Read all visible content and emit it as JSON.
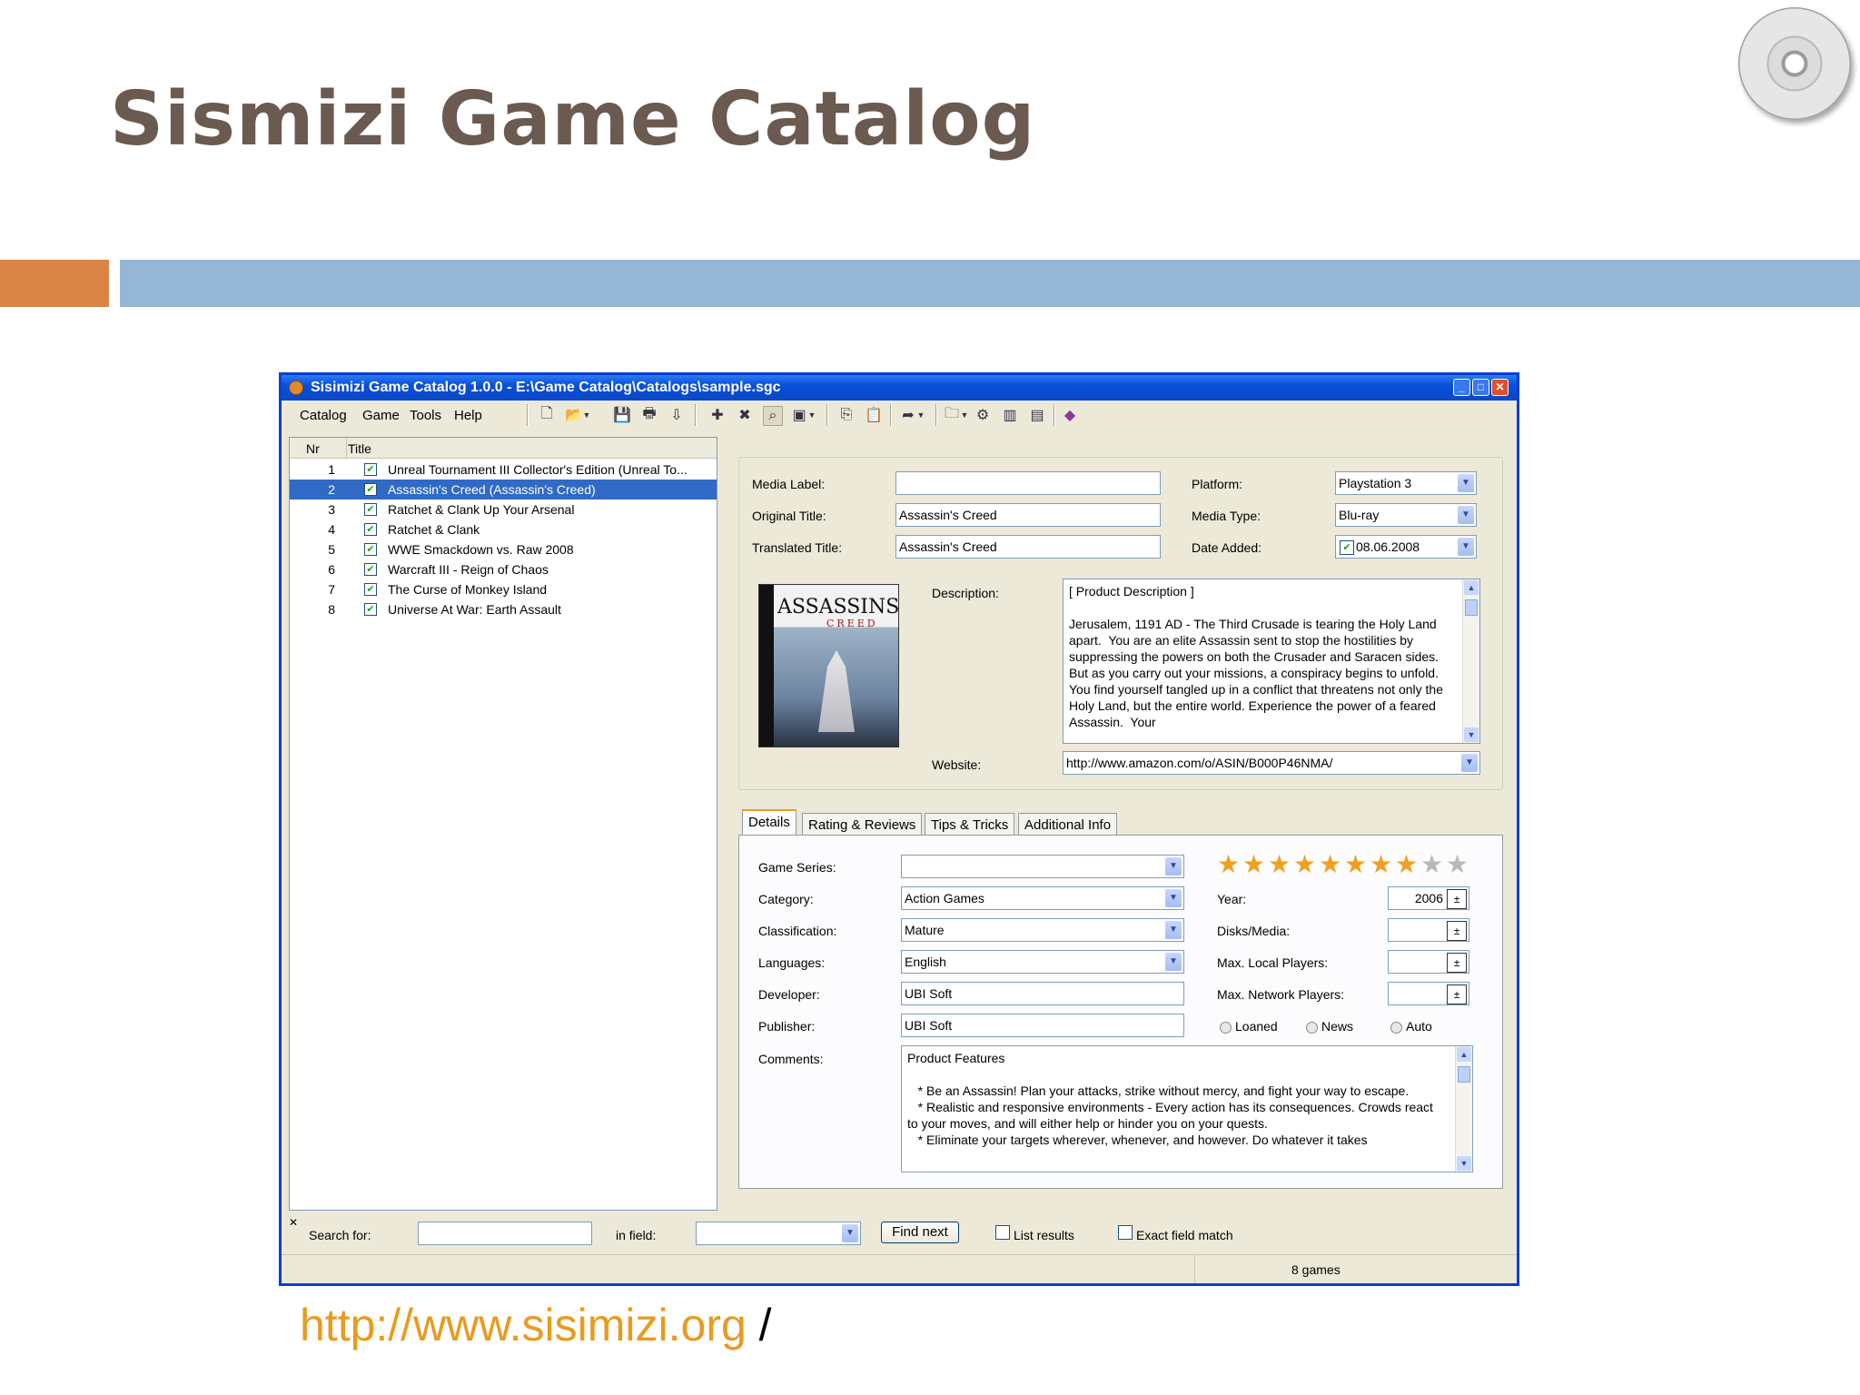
{
  "slide": {
    "title": "Sismizi Game Catalog",
    "url": "http://www.sisimizi.org",
    "url_suffix": " /",
    "colors": {
      "title": "#6a5a50",
      "accent_orange": "#d98548",
      "accent_blue": "#96b6d6",
      "url": "#e89b1e"
    }
  },
  "window": {
    "title": "Sisimizi Game Catalog 1.0.0 - E:\\Game Catalog\\Catalogs\\sample.sgc",
    "controls": [
      "minimize",
      "maximize",
      "close"
    ]
  },
  "menu": [
    "Catalog",
    "Game",
    "Tools",
    "Help"
  ],
  "toolbar_icons": [
    "new-icon",
    "open-icon",
    "dropdown-icon",
    "save-icon",
    "print-icon",
    "export-icon",
    "add-game-icon",
    "delete-game-icon",
    "find-icon",
    "picture-icon",
    "dropdown-icon",
    "copy-icon",
    "paste-icon",
    "move-icon",
    "dropdown-icon",
    "folder-icon",
    "dropdown-icon",
    "settings-icon",
    "statistics-icon",
    "report-icon",
    "help-book-icon"
  ],
  "list": {
    "headers": {
      "nr": "Nr",
      "title": "Title"
    },
    "rows": [
      {
        "nr": "1",
        "title": "Unreal Tournament III Collector's Edition (Unreal To...",
        "checked": true
      },
      {
        "nr": "2",
        "title": "Assassin's Creed (Assassin's Creed)",
        "checked": true,
        "selected": true
      },
      {
        "nr": "3",
        "title": "Ratchet & Clank Up Your Arsenal",
        "checked": true
      },
      {
        "nr": "4",
        "title": "Ratchet & Clank",
        "checked": true
      },
      {
        "nr": "5",
        "title": "WWE Smackdown vs. Raw 2008",
        "checked": true
      },
      {
        "nr": "6",
        "title": "Warcraft III - Reign of Chaos",
        "checked": true
      },
      {
        "nr": "7",
        "title": "The Curse of Monkey Island",
        "checked": true
      },
      {
        "nr": "8",
        "title": "Universe At War: Earth Assault",
        "checked": true
      }
    ]
  },
  "details": {
    "media_label": {
      "label": "Media Label:",
      "value": ""
    },
    "original_title": {
      "label": "Original Title:",
      "value": "Assassin's Creed"
    },
    "translated_title": {
      "label": "Translated Title:",
      "value": "Assassin's Creed"
    },
    "platform": {
      "label": "Platform:",
      "value": "Playstation 3"
    },
    "media_type": {
      "label": "Media Type:",
      "value": "Blu-ray"
    },
    "date_added": {
      "label": "Date Added:",
      "value": "08.06.2008"
    },
    "description": {
      "label": "Description:",
      "value": "[ Product Description ]\n\nJerusalem, 1191 AD - The Third Crusade is tearing the Holy Land apart.  You are an elite Assassin sent to stop the hostilities by suppressing the powers on both the Crusader and Saracen sides.  But as you carry out your missions, a conspiracy begins to unfold.  You find yourself tangled up in a conflict that threatens not only the Holy Land, but the entire world. Experience the power of a feared Assassin.  Your"
    },
    "website": {
      "label": "Website:",
      "value": "http://www.amazon.com/o/ASIN/B000P46NMA/"
    },
    "cover": {
      "title": "ASSASSINS",
      "subtitle": "CREED"
    }
  },
  "tabs": [
    "Details",
    "Rating & Reviews",
    "Tips & Tricks",
    "Additional Info"
  ],
  "tab_details": {
    "game_series": {
      "label": "Game Series:",
      "value": ""
    },
    "category": {
      "label": "Category:",
      "value": "Action Games"
    },
    "classification": {
      "label": "Classification:",
      "value": "Mature"
    },
    "languages": {
      "label": "Languages:",
      "value": "English"
    },
    "developer": {
      "label": "Developer:",
      "value": "UBI Soft"
    },
    "publisher": {
      "label": "Publisher:",
      "value": "UBI Soft"
    },
    "comments": {
      "label": "Comments:",
      "value": "Product Features\n\n   * Be an Assassin! Plan your attacks, strike without mercy, and fight your way to escape.\n   * Realistic and responsive environments - Every action has its consequences. Crowds react to your moves, and will either help or hinder you on your quests.\n   * Eliminate your targets wherever, whenever, and however. Do whatever it takes"
    },
    "rating": {
      "value": 8,
      "max": 10
    },
    "year": {
      "label": "Year:",
      "value": "2006"
    },
    "disks_media": {
      "label": "Disks/Media:",
      "value": ""
    },
    "max_local_players": {
      "label": "Max. Local Players:",
      "value": ""
    },
    "max_network_players": {
      "label": "Max. Network Players:",
      "value": ""
    },
    "radios": [
      "Loaned",
      "News",
      "Auto"
    ]
  },
  "search": {
    "label": "Search for:",
    "value": "",
    "in_field_label": "in field:",
    "in_field_value": "",
    "find_next": "Find next",
    "list_results": "List results",
    "exact_match": "Exact field match"
  },
  "status": {
    "count": "8 games"
  }
}
